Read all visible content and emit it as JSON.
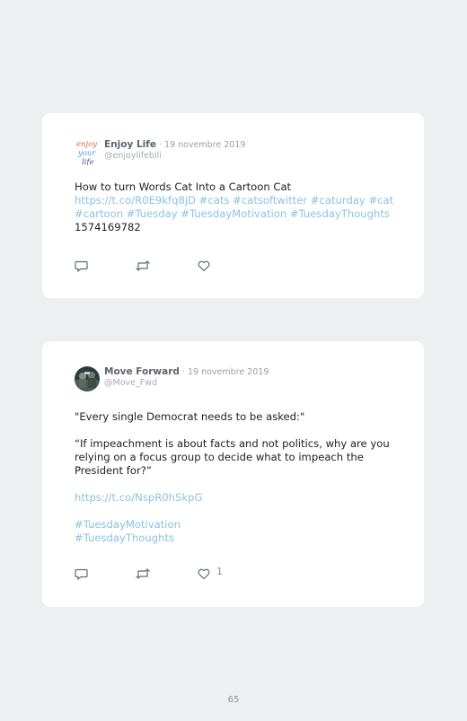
{
  "tweets": [
    {
      "author": "Enjoy Life",
      "date": " · 19 novembre 2019",
      "handle": "@enjoylifebili",
      "body_text": "How to turn Words Cat Into a Cartoon Cat",
      "body_links": "https://t.co/R0E9kfq8jD #cats #catsoftwitter #caturday #cat #cartoon #Tuesday #TuesdayMotivation #TuesdayThoughts",
      "body_tail": " 1574169782",
      "like_count": "",
      "avatar_icon": "enjoy-your-life-logo",
      "avatar_text": [
        "enjoy",
        "your",
        "life"
      ]
    },
    {
      "author": "Move Forward",
      "date": " · 19 novembre 2019",
      "handle": "@Move_Fwd",
      "paragraph_1": "\"Every single Democrat needs to be asked:\"",
      "paragraph_2": "“If impeachment is about facts and not politics, why are you relying on a focus group to decide what to impeach the President for?”",
      "link_url": "https://t.co/NspR0hSkpG",
      "hashtag_1": "#TuesdayMotivation",
      "hashtag_2": "#TuesdayThoughts",
      "like_count": "1",
      "avatar_icon": "soldiers-photo-avatar"
    }
  ],
  "icons": [
    "reply-icon",
    "retweet-icon",
    "like-icon"
  ],
  "colors": {
    "page_background": "#eeeff0",
    "card_background": "#ffffff",
    "link": "#8cc2e2",
    "muted": "#a6abb1"
  },
  "page_number": "65"
}
